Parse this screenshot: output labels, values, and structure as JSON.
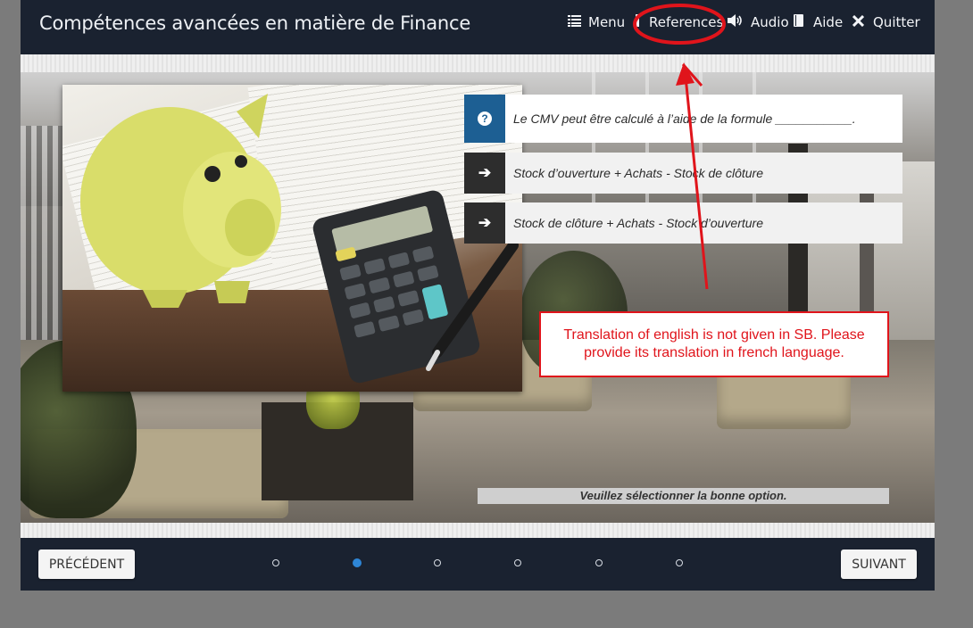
{
  "header": {
    "title": "Compétences avancées en matière de Finance",
    "menu": [
      {
        "label": "Menu",
        "icon": "list-icon"
      },
      {
        "label": "References",
        "icon": "references-icon"
      },
      {
        "label": "Audio",
        "icon": "speaker-icon"
      },
      {
        "label": "Aide",
        "icon": "book-icon"
      },
      {
        "label": "Quitter",
        "icon": "close-icon"
      }
    ]
  },
  "question": {
    "icon": "question-icon",
    "text": "Le CMV peut être calculé à l’aide de la formule ___________.",
    "options": [
      {
        "text": "Stock d’ouverture + Achats - Stock de clôture",
        "icon": "arrow-right-icon"
      },
      {
        "text": "Stock de clôture + Achats - Stock d’ouverture",
        "icon": "arrow-right-icon"
      }
    ],
    "instruction": "Veuillez sélectionner la bonne option."
  },
  "annotation": {
    "text": "Translation of english is not given in SB. Please provide its translation in french language.",
    "color": "#e0141b"
  },
  "footer": {
    "prev_label": "PRÉCÉDENT",
    "next_label": "SUIVANT",
    "pagination": {
      "total": 6,
      "active": 2
    }
  },
  "colors": {
    "topbar": "#1a2230",
    "question_badge": "#1d5f93",
    "option_badge": "#2d2d2d",
    "active_dot": "#2e86d6"
  }
}
